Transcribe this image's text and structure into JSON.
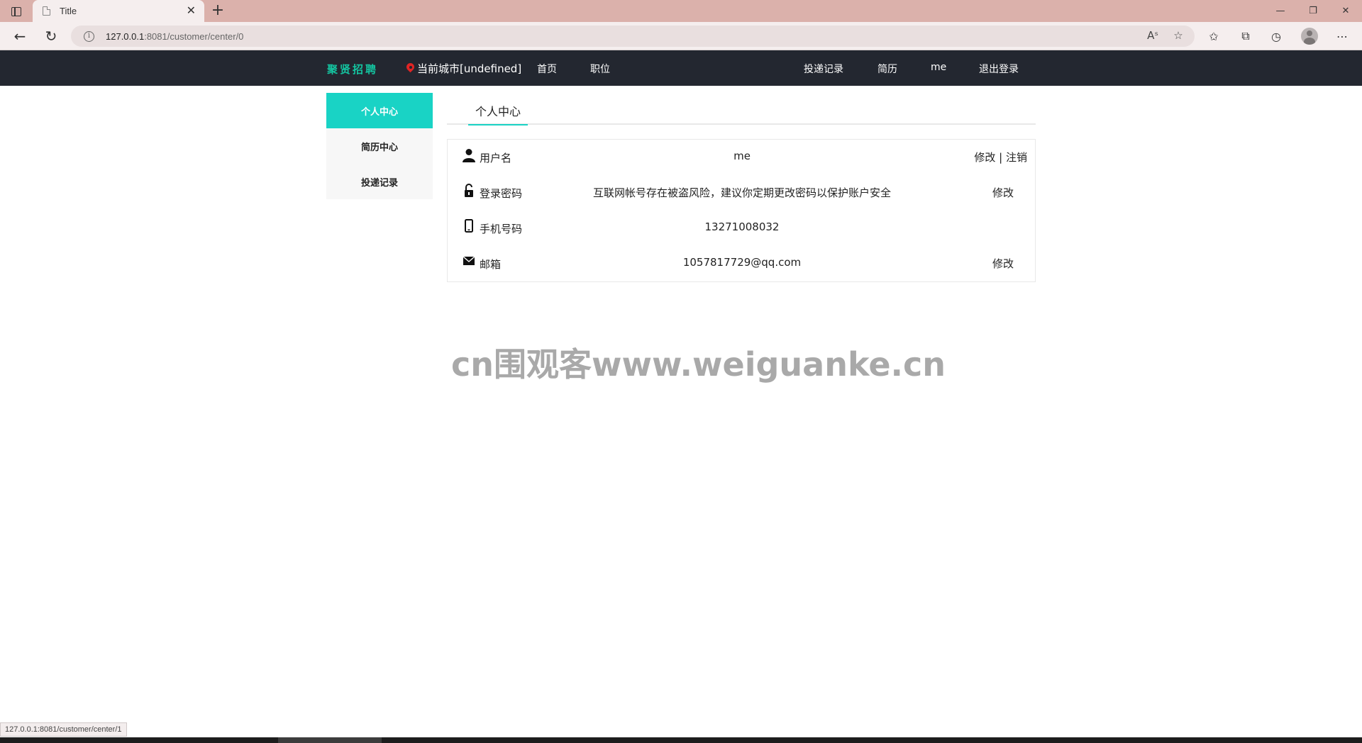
{
  "browser": {
    "tab_title": "Title",
    "url_host": "127.0.0.1",
    "url_rest": ":8081/customer/center/0",
    "status_url": "127.0.0.1:8081/customer/center/1"
  },
  "site": {
    "logo": "聚贤招聘",
    "city_label": "当前城市[undefined]",
    "nav_left": [
      "首页",
      "职位"
    ],
    "nav_right": [
      "投递记录",
      "简历",
      "me",
      "退出登录"
    ]
  },
  "sidebar": {
    "items": [
      {
        "label": "个人中心",
        "active": true
      },
      {
        "label": "简历中心",
        "active": false
      },
      {
        "label": "投递记录",
        "active": false
      }
    ]
  },
  "main": {
    "tab": "个人中心",
    "rows": [
      {
        "icon": "user-icon",
        "label": "用户名",
        "value": "me",
        "action": "修改",
        "action2": "注销"
      },
      {
        "icon": "lock-icon",
        "label": "登录密码",
        "value": "互联网帐号存在被盗风险，建议你定期更改密码以保护账户安全",
        "action": "修改"
      },
      {
        "icon": "phone-icon",
        "label": "手机号码",
        "value": "13271008032"
      },
      {
        "icon": "mail-icon",
        "label": "邮箱",
        "value": "1057817729@qq.com",
        "action": "修改"
      }
    ]
  },
  "watermark": "cn围观客www.weiguanke.cn",
  "colors": {
    "accent": "#19d3c5",
    "nav_bg": "#232730",
    "logo": "#14c4a0",
    "pin": "#e02424",
    "tabbar": "#dbb1ab"
  }
}
